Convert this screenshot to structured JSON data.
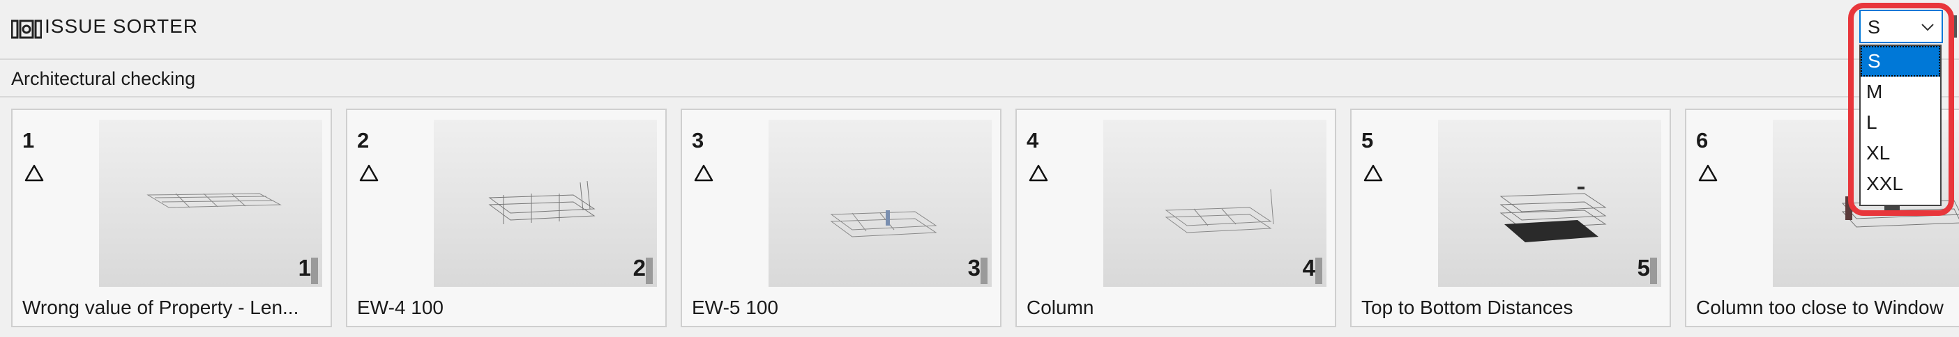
{
  "header": {
    "title": "ISSUE SORTER"
  },
  "subheader": {
    "label": "Architectural checking"
  },
  "size_select": {
    "value": "S",
    "options": [
      "S",
      "M",
      "L",
      "XL",
      "XXL"
    ],
    "selected_index": 0
  },
  "cards": [
    {
      "number": "1",
      "count": "1",
      "label": "Wrong value of Property - Len..."
    },
    {
      "number": "2",
      "count": "2",
      "label": "EW-4 100"
    },
    {
      "number": "3",
      "count": "3",
      "label": "EW-5 100"
    },
    {
      "number": "4",
      "count": "4",
      "label": "Column"
    },
    {
      "number": "5",
      "count": "5",
      "label": "Top to Bottom Distances"
    },
    {
      "number": "6",
      "count": "",
      "label": "Column too close to Window"
    }
  ],
  "colors": {
    "accent": "#0078d7",
    "highlight": "#e8363b"
  }
}
